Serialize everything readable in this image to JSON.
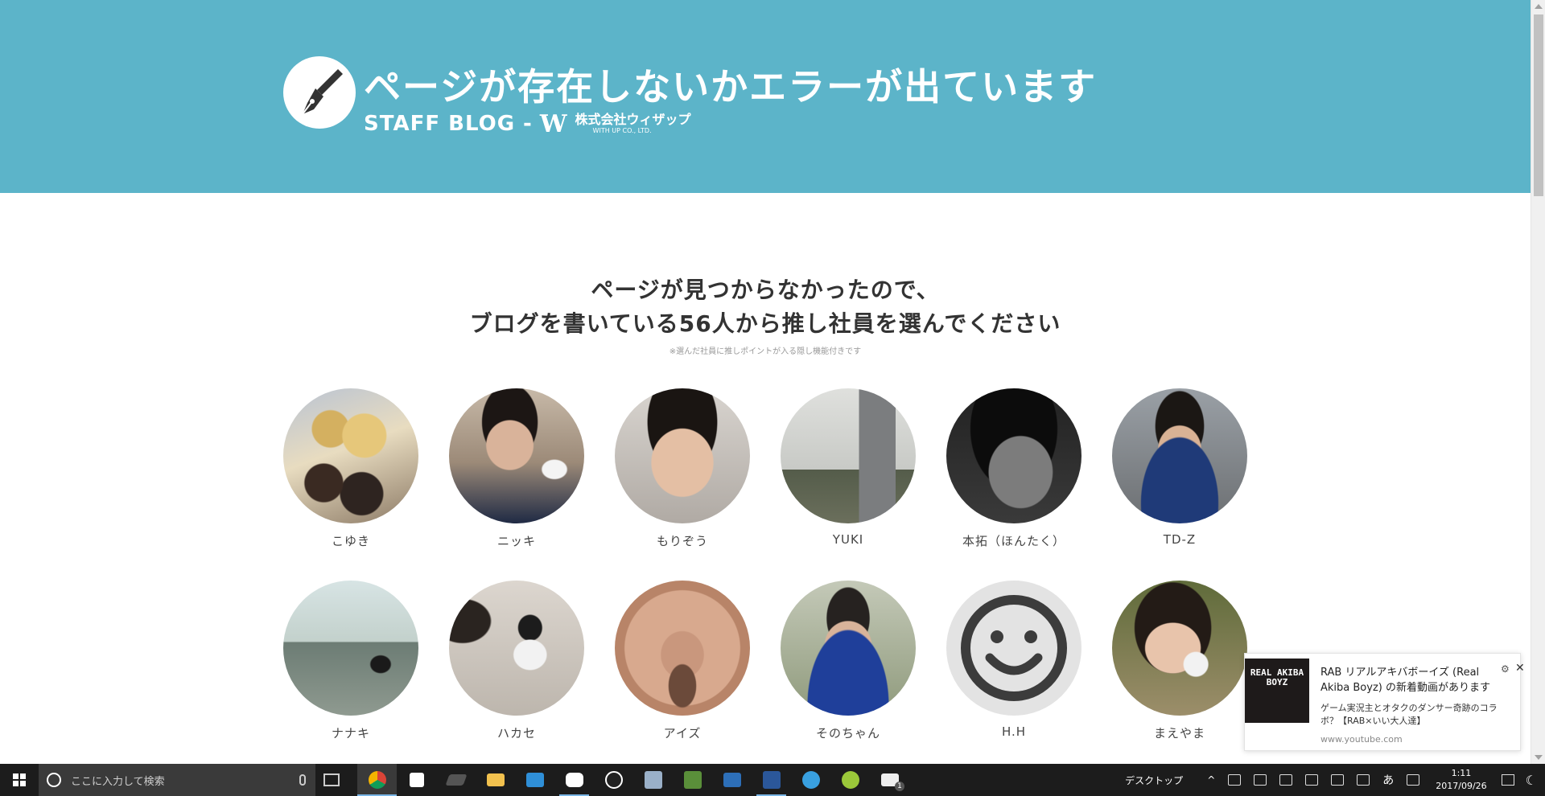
{
  "header": {
    "title": "ページが存在しないかエラーが出ています",
    "staff_blog": "STAFF BLOG",
    "dash": "-",
    "w_mark": "W",
    "company_jp": "株式会社ウィザップ",
    "company_en": "WITH UP CO., LTD."
  },
  "main": {
    "heading_line1": "ページが見つからなかったので、",
    "heading_line2": "ブログを書いている56人から推し社員を選んでください",
    "note": "※選んだ社員に推しポイントが入る隠し機能付きです",
    "staff": [
      {
        "name": "こゆき"
      },
      {
        "name": "ニッキ"
      },
      {
        "name": "もりぞう"
      },
      {
        "name": "YUKI"
      },
      {
        "name": "本拓（ほんたく）"
      },
      {
        "name": "TD-Z"
      },
      {
        "name": "ナナキ"
      },
      {
        "name": "ハカセ"
      },
      {
        "name": "アイズ"
      },
      {
        "name": "そのちゃん"
      },
      {
        "name": "H.H"
      },
      {
        "name": "まえやま"
      }
    ]
  },
  "notification": {
    "thumb_text": "REAL AKIBA BOYZ",
    "title": "RAB リアルアキバボーイズ (Real Akiba Boyz) の新着動画があります",
    "body": "ゲーム実況主とオタクのダンサー奇跡のコラボ？【RAB×いい大人達】",
    "source": "www.youtube.com"
  },
  "taskbar": {
    "search_placeholder": "ここに入力して検索",
    "desktop_label": "デスクトップ",
    "ime_label": "あ",
    "time": "1:11",
    "date": "2017/09/26",
    "mail_badge": "1"
  },
  "colors": {
    "header_bg": "#5cb4c9",
    "taskbar_bg": "#1c1c1c",
    "accent": "#7ab6e6"
  }
}
